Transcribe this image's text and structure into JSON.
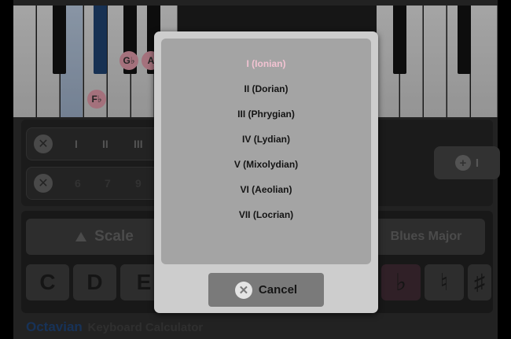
{
  "keyboard": {
    "note_labels": [
      "F♭",
      "G♭",
      "A"
    ]
  },
  "degrees": {
    "row1": [
      "I",
      "II",
      "III"
    ],
    "row2": [
      "6",
      "7",
      "9"
    ],
    "add_button": "I"
  },
  "controls": {
    "scale_label": "Scale",
    "scale_type": "Blues Major",
    "notes": [
      "C",
      "D",
      "E"
    ],
    "accidentals": [
      "♭",
      "♮",
      "♯"
    ]
  },
  "footer": {
    "brand": "Octavian",
    "subtitle": "Keyboard Calculator"
  },
  "modal": {
    "modes": [
      "I (Ionian)",
      "II (Dorian)",
      "III (Phrygian)",
      "IV (Lydian)",
      "V (Mixolydian)",
      "VI (Aeolian)",
      "VII (Locrian)"
    ],
    "selected_index": 0,
    "cancel_label": "Cancel"
  },
  "colors": {
    "selected_mode": "#f2c3d2",
    "brand": "#1d3d6b",
    "note_marker": "#c98a98"
  },
  "icons": {
    "remove": "close-icon",
    "add": "plus-icon",
    "cancel": "close-icon",
    "scale_toggle": "triangle-up-icon"
  }
}
